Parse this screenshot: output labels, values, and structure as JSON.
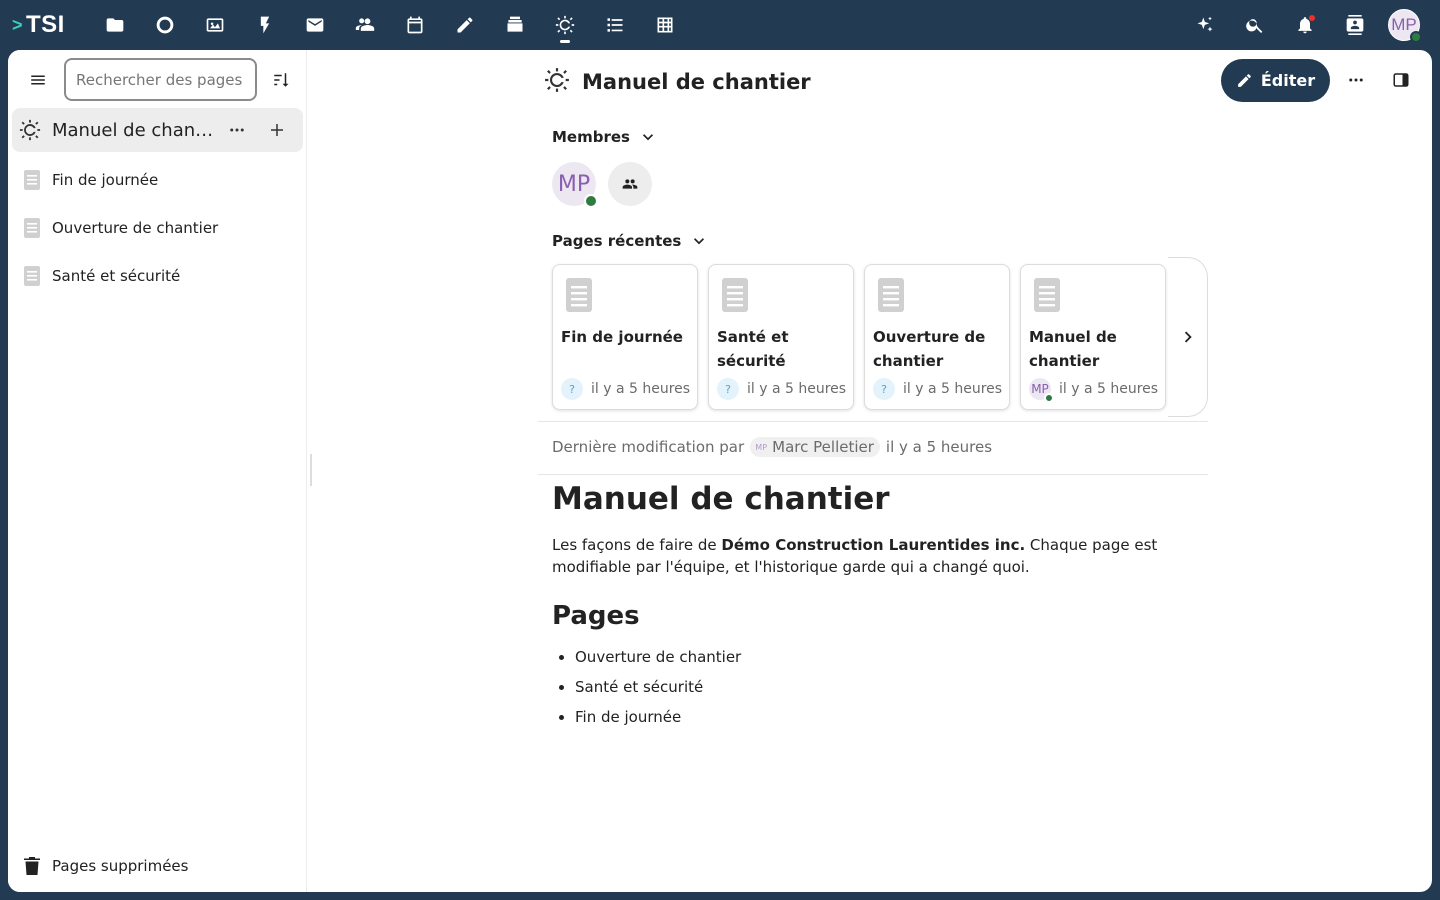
{
  "topbar": {
    "logo_text": "TSI",
    "logo_chevron": ">",
    "apps": [
      {
        "name": "files-icon"
      },
      {
        "name": "activity-icon"
      },
      {
        "name": "photos-icon"
      },
      {
        "name": "flash-icon"
      },
      {
        "name": "mail-icon"
      },
      {
        "name": "contacts-icon"
      },
      {
        "name": "calendar-icon"
      },
      {
        "name": "notes-icon"
      },
      {
        "name": "deck-icon"
      },
      {
        "name": "collectives-icon",
        "active": true
      },
      {
        "name": "tasks-icon"
      },
      {
        "name": "tables-icon"
      }
    ],
    "user_initials": "MP"
  },
  "sidebar": {
    "search_placeholder": "Rechercher des pages",
    "collective": {
      "label": "Manuel de chantier"
    },
    "pages": [
      {
        "label": "Fin de journée"
      },
      {
        "label": "Ouverture de chantier"
      },
      {
        "label": "Santé et sécurité"
      }
    ],
    "trash_label": "Pages supprimées"
  },
  "header": {
    "title": "Manuel de chantier",
    "edit_label": "Éditer"
  },
  "members": {
    "heading": "Membres",
    "avatar_initials": "MP"
  },
  "recent": {
    "heading": "Pages récentes",
    "cards": [
      {
        "title": "Fin de journée",
        "time": "il y a 5 heures",
        "badge": "?"
      },
      {
        "title": "Santé et sécurité",
        "time": "il y a 5 heures",
        "badge": "?"
      },
      {
        "title": "Ouverture de chantier",
        "time": "il y a 5 heures",
        "badge": "?"
      },
      {
        "title": "Manuel de chantier",
        "time": "il y a 5 heures",
        "badge": "MP"
      }
    ]
  },
  "last_modified": {
    "prefix": "Dernière modification par",
    "user_initials": "MP",
    "user_name": "Marc Pelletier",
    "time": "il y a 5 heures"
  },
  "document": {
    "title": "Manuel de chantier",
    "intro_before": "Les façons de faire de ",
    "intro_bold": "Démo Construction Laurentides inc.",
    "intro_after": " Chaque page est modifiable par l'équipe, et l'historique garde qui a changé quoi.",
    "pages_heading": "Pages",
    "pages_list": [
      "Ouverture de chantier",
      "Santé et sécurité",
      "Fin de journée"
    ]
  },
  "colors": {
    "topbar_bg": "#223a52",
    "accent": "#223a52",
    "online": "#2d7b41",
    "avatar_text": "#8a5fb0"
  }
}
